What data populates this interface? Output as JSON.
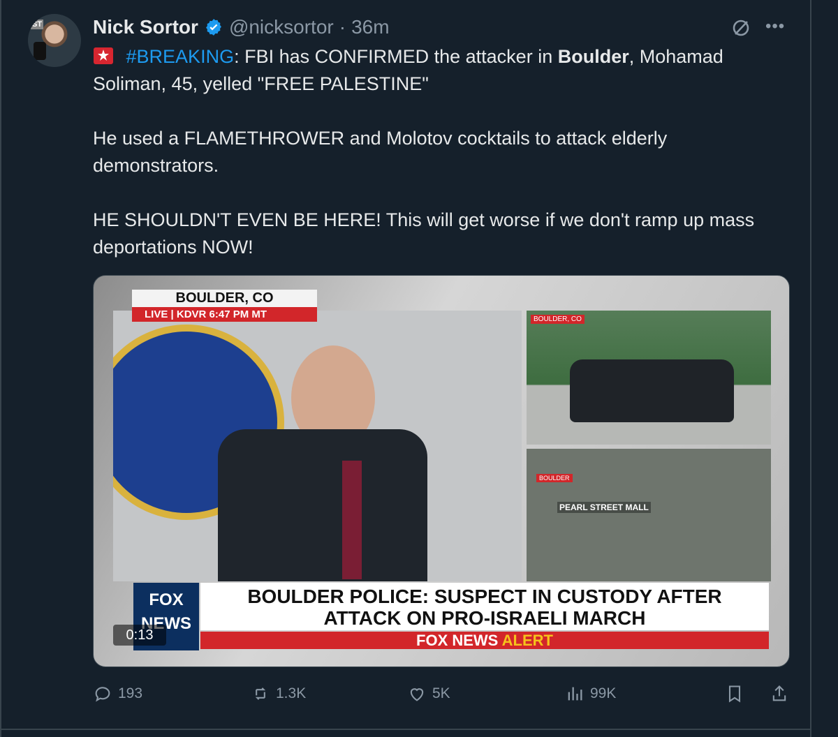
{
  "author": {
    "name": "Nick Sortor",
    "handle": "@nicksortor",
    "separator": "·",
    "time": "36m"
  },
  "tweet": {
    "hashtag": "#BREAKING",
    "line1_prefix": ": FBI has CONFIRMED the attacker in ",
    "line1_bold": "Boulder",
    "line1_suffix": ", Mohamad Soliman, 45, yelled \"FREE PALESTINE\"",
    "paragraph2": "He used a FLAMETHROWER and Molotov cocktails to attack elderly demonstrators.",
    "paragraph3": "HE SHOULDN'T EVEN BE HERE! This will get worse if we don't ramp up mass deportations NOW!"
  },
  "media": {
    "location": "BOULDER, CO",
    "live_bar": "LIVE | KDVR 6:47 PM MT",
    "inset_label_top": "BOULDER, CO",
    "inset_label_bottom": "BOULDER",
    "map_label": "PEARL STREET MALL",
    "logo_text": "FOX NEWS",
    "headline_line1": "BOULDER POLICE: SUSPECT IN CUSTODY AFTER",
    "headline_line2": "ATTACK ON PRO-ISRAELI MARCH",
    "alert_left": "FOX NEWS",
    "alert_right": "ALERT",
    "video_time": "0:13"
  },
  "actions": {
    "replies": "193",
    "reposts": "1.3K",
    "likes": "5K",
    "views": "99K"
  },
  "colors": {
    "background": "#15202b",
    "text": "#e7e9ea",
    "muted": "#8b98a5",
    "accent": "#1d9bf0",
    "alert_red": "#d2262a"
  },
  "icons": [
    "verified-badge-icon",
    "grok-icon",
    "more-icon",
    "siren-icon",
    "reply-icon",
    "repost-icon",
    "like-icon",
    "views-icon",
    "bookmark-icon",
    "share-icon"
  ]
}
